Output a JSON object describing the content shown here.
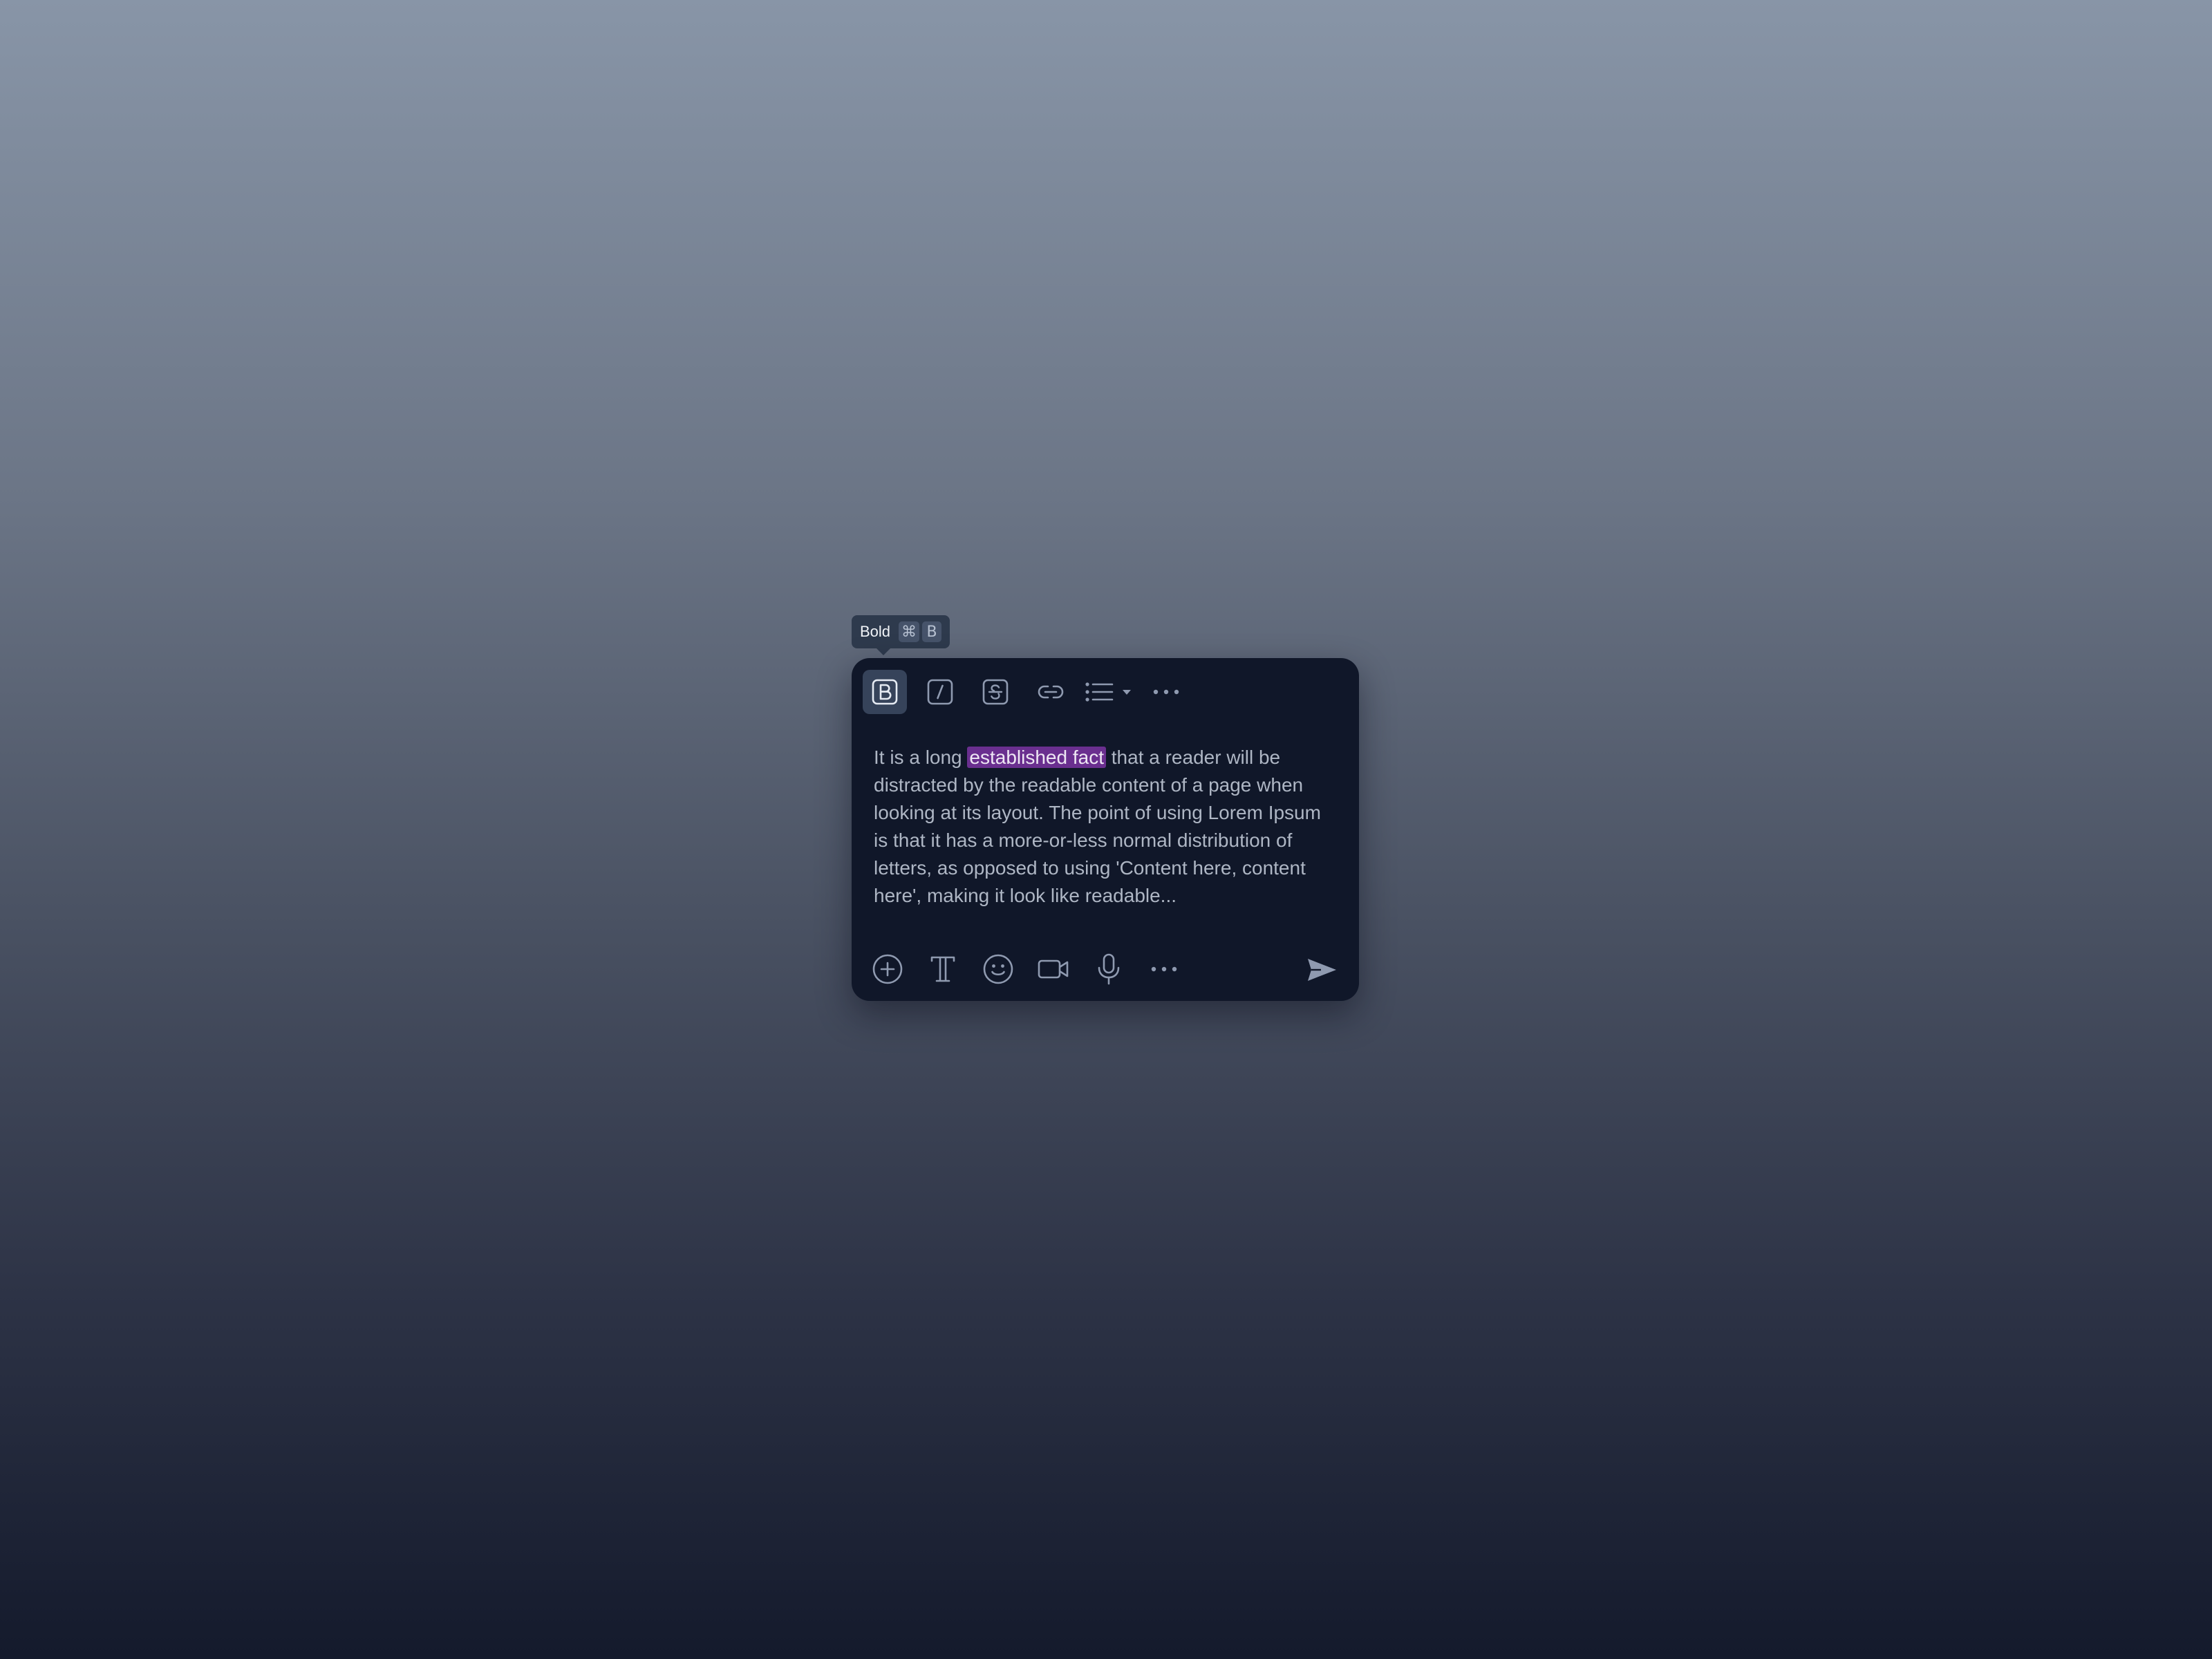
{
  "tooltip": {
    "label": "Bold",
    "keys": [
      "⌘",
      "B"
    ]
  },
  "toolbar": {
    "items": [
      {
        "name": "bold",
        "icon": "bold-icon",
        "active": true
      },
      {
        "name": "italic",
        "icon": "italic-icon",
        "active": false
      },
      {
        "name": "strikethrough",
        "icon": "strikethrough-icon",
        "active": false
      },
      {
        "name": "link",
        "icon": "link-icon",
        "active": false
      },
      {
        "name": "list",
        "icon": "bulleted-list-icon",
        "active": false
      },
      {
        "name": "more",
        "icon": "more-horizontal-icon",
        "active": false
      }
    ]
  },
  "editor": {
    "text_before": "It is a long ",
    "highlighted": "established fact",
    "text_after": " that a reader will be distracted by the readable content of a page when looking at its layout. The point of using Lorem Ipsum is that it has a more-or-less normal distribution of letters, as opposed to using 'Content here, content here', making it look like readable..."
  },
  "bottombar": {
    "items": [
      {
        "name": "attach",
        "icon": "plus-circle-icon"
      },
      {
        "name": "text-format",
        "icon": "text-format-icon"
      },
      {
        "name": "emoji",
        "icon": "smiley-icon"
      },
      {
        "name": "video",
        "icon": "video-camera-icon"
      },
      {
        "name": "audio",
        "icon": "microphone-icon"
      },
      {
        "name": "more",
        "icon": "more-horizontal-icon"
      }
    ],
    "send_icon": "send-icon"
  },
  "colors": {
    "card_background": "#101729",
    "active_button": "#36435a",
    "highlight": "#6a2f8f",
    "icon": "#8f9ab0",
    "text": "#aeb6c4"
  }
}
